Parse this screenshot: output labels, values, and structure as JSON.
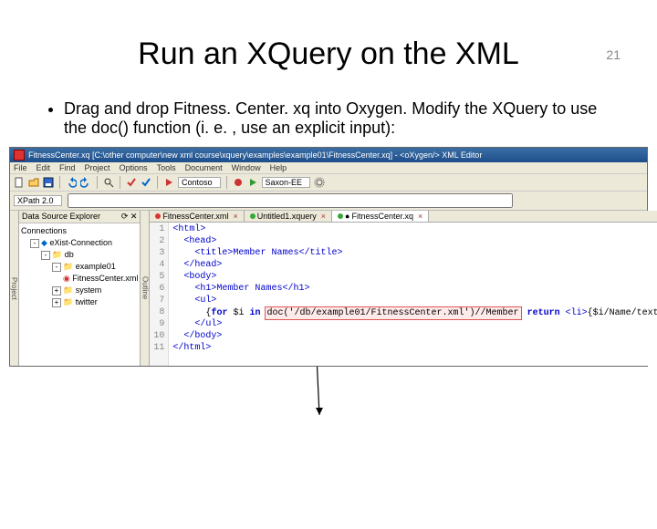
{
  "page_number": "21",
  "title": "Run an XQuery on the XML",
  "bullet_text": "Drag and drop Fitness. Center. xq into Oxygen. Modify the XQuery to use the doc() function (i. e. , use an explicit input):",
  "window_title": "FitnessCenter.xq [C:\\other computer\\new xml course\\xquery\\examples\\example01\\FitnessCenter.xq] - <oXygen/> XML Editor",
  "menus": [
    "File",
    "Edit",
    "Find",
    "Project",
    "Options",
    "Tools",
    "Document",
    "Window",
    "Help"
  ],
  "toolbar": {
    "scenario_label": "Contoso",
    "engine_label": "Saxon-EE"
  },
  "xpath_label": "XPath 2.0",
  "side_tabs": {
    "project": "Project",
    "outline": "Outline"
  },
  "explorer": {
    "title": "Data Source Explorer",
    "connections": "Connections",
    "items": [
      {
        "label": "eXist-Connection",
        "icon": "db"
      },
      {
        "label": "db",
        "icon": "folder"
      },
      {
        "label": "example01",
        "icon": "folder"
      },
      {
        "label": "FitnessCenter.xml",
        "icon": "xml"
      },
      {
        "label": "system",
        "icon": "folder"
      },
      {
        "label": "twitter",
        "icon": "folder"
      }
    ]
  },
  "tabs": [
    {
      "label": "FitnessCenter.xml",
      "dirty": false,
      "kind": "xml"
    },
    {
      "label": "Untitled1.xquery",
      "dirty": false,
      "kind": "xq"
    },
    {
      "label": "FitnessCenter.xq",
      "dirty": true,
      "kind": "xq"
    }
  ],
  "code": {
    "lines": [
      "<html>",
      "  <head>",
      "    <title>Member Names</title>",
      "  </head>",
      "  <body>",
      "    <h1>Member Names</h1>",
      "    <ul>",
      "      {for $i in doc('/db/example01/FitnessCenter.xml')//Member return <li>{$i/Name/text()}</li>}",
      "    </ul>",
      "  </body>",
      "</html>"
    ],
    "highlight_fragment": "doc('/db/example01/FitnessCenter.xml')//Member"
  }
}
